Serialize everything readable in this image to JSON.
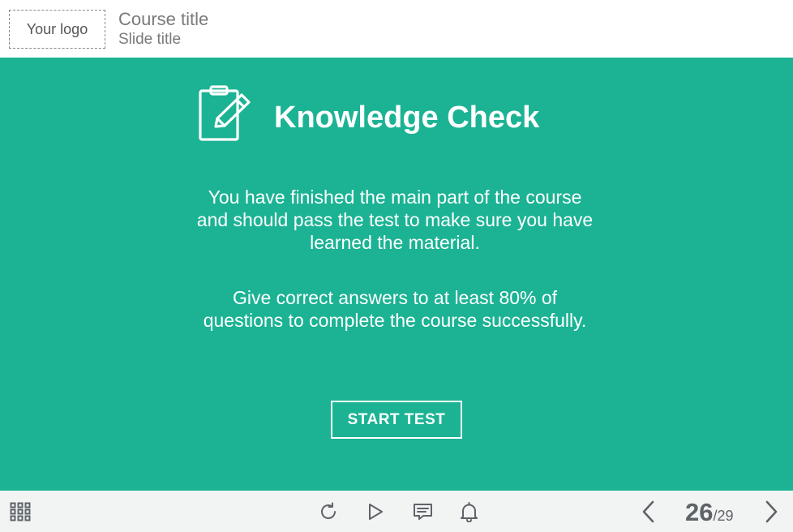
{
  "header": {
    "logo_text": "Your logo",
    "course_title": "Course title",
    "slide_title": "Slide title"
  },
  "main": {
    "background_color": "#1bb394",
    "icon": "clipboard-pencil-icon",
    "title": "Knowledge Check",
    "paragraph1": "You have finished the main part of the course and should pass the test to make sure you have learned the material.",
    "paragraph2": "Give correct answers to at least 80% of questions to complete the course successfully.",
    "start_button_label": "START TEST"
  },
  "footer": {
    "icons": [
      "grid-menu-icon",
      "replay-icon",
      "play-icon",
      "comment-icon",
      "bell-icon",
      "chevron-left-icon",
      "chevron-right-icon"
    ],
    "page_current": "26",
    "page_total": "/29"
  }
}
